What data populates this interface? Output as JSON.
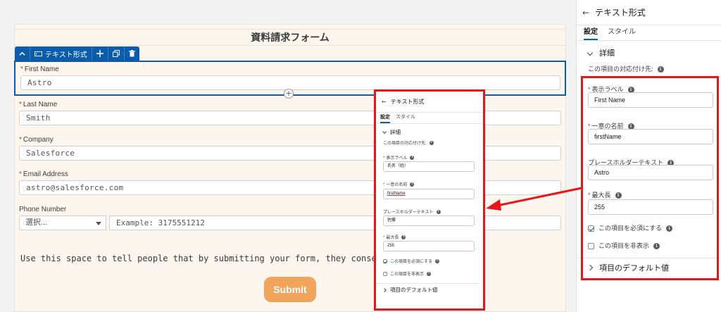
{
  "form": {
    "title": "資料請求フォーム",
    "toolbar": {
      "component_label": "テキスト形式"
    },
    "fields": {
      "first_name": {
        "label": "First Name",
        "value": "Astro"
      },
      "last_name": {
        "label": "Last Name",
        "value": "Smith"
      },
      "company": {
        "label": "Company",
        "value": "Salesforce"
      },
      "email": {
        "label": "Email Address",
        "value": "astro@salesforce.com"
      },
      "phone": {
        "label": "Phone Number",
        "select_value": "選択...",
        "placeholder": "Example: 3175551212"
      }
    },
    "consent_text": "Use this space to tell people that by submitting your form, they consent to receive marketing",
    "submit_label": "Submit"
  },
  "panel": {
    "back_arrow": "←",
    "title": "テキスト形式",
    "tabs": {
      "settings": "設定",
      "style": "スタイル"
    },
    "details_section": "詳細",
    "mapping_label": "この項目の対応付け先:",
    "display_label_label": "表示ラベル",
    "unique_name_label": "一意の名前",
    "placeholder_label": "プレースホルダーテキスト",
    "max_length_label": "最大長",
    "required_label": "この項目を必須にする",
    "hidden_label": "この項目を非表示",
    "default_section": "項目のデフォルト値"
  },
  "right_panel_values": {
    "display_label": "First Name",
    "unique_name": "firstName",
    "placeholder": "Astro",
    "max_length": "255"
  },
  "popup_values": {
    "display_label": "氏名（姓）",
    "unique_name": "firstName",
    "placeholder": "佐藤",
    "max_length": "255"
  },
  "colors": {
    "highlight_red": "#e8161b",
    "selection_blue": "#0b5cab",
    "submit_orange": "#f1a45c",
    "form_background": "#fdf6ee"
  }
}
